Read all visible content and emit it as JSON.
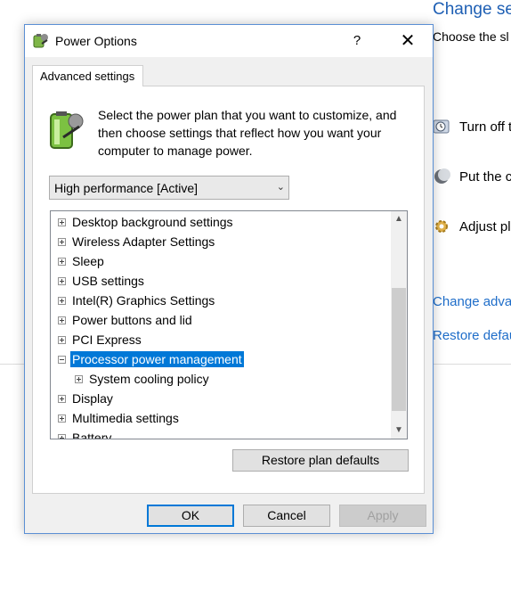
{
  "background": {
    "title": "Change se",
    "subtitle": "Choose the sl",
    "items": [
      {
        "label": "Turn off t"
      },
      {
        "label": "Put the c"
      },
      {
        "label": "Adjust pl"
      }
    ],
    "links": [
      {
        "label": "Change adva"
      },
      {
        "label": "Restore defau"
      }
    ]
  },
  "dialog": {
    "title": "Power Options",
    "help_label": "?",
    "close_label": "✕",
    "tab_label": "Advanced settings",
    "intro": "Select the power plan that you want to customize, and then choose settings that reflect how you want your computer to manage power.",
    "plan_select": {
      "value": "High performance [Active]"
    },
    "tree": {
      "items": [
        {
          "label": "Desktop background settings",
          "state": "collapsed",
          "indent": 0
        },
        {
          "label": "Wireless Adapter Settings",
          "state": "collapsed",
          "indent": 0
        },
        {
          "label": "Sleep",
          "state": "collapsed",
          "indent": 0
        },
        {
          "label": "USB settings",
          "state": "collapsed",
          "indent": 0
        },
        {
          "label": "Intel(R) Graphics Settings",
          "state": "collapsed",
          "indent": 0
        },
        {
          "label": "Power buttons and lid",
          "state": "collapsed",
          "indent": 0
        },
        {
          "label": "PCI Express",
          "state": "collapsed",
          "indent": 0
        },
        {
          "label": "Processor power management",
          "state": "expanded",
          "indent": 0,
          "selected": true
        },
        {
          "label": "System cooling policy",
          "state": "collapsed",
          "indent": 1
        },
        {
          "label": "Display",
          "state": "collapsed",
          "indent": 0
        },
        {
          "label": "Multimedia settings",
          "state": "collapsed",
          "indent": 0
        },
        {
          "label": "Battery",
          "state": "collapsed",
          "indent": 0
        }
      ]
    },
    "restore_label": "Restore plan defaults",
    "ok_label": "OK",
    "cancel_label": "Cancel",
    "apply_label": "Apply",
    "colors": {
      "accent": "#0078d7",
      "link": "#1e6dc9",
      "border": "#5b8fd4"
    }
  }
}
